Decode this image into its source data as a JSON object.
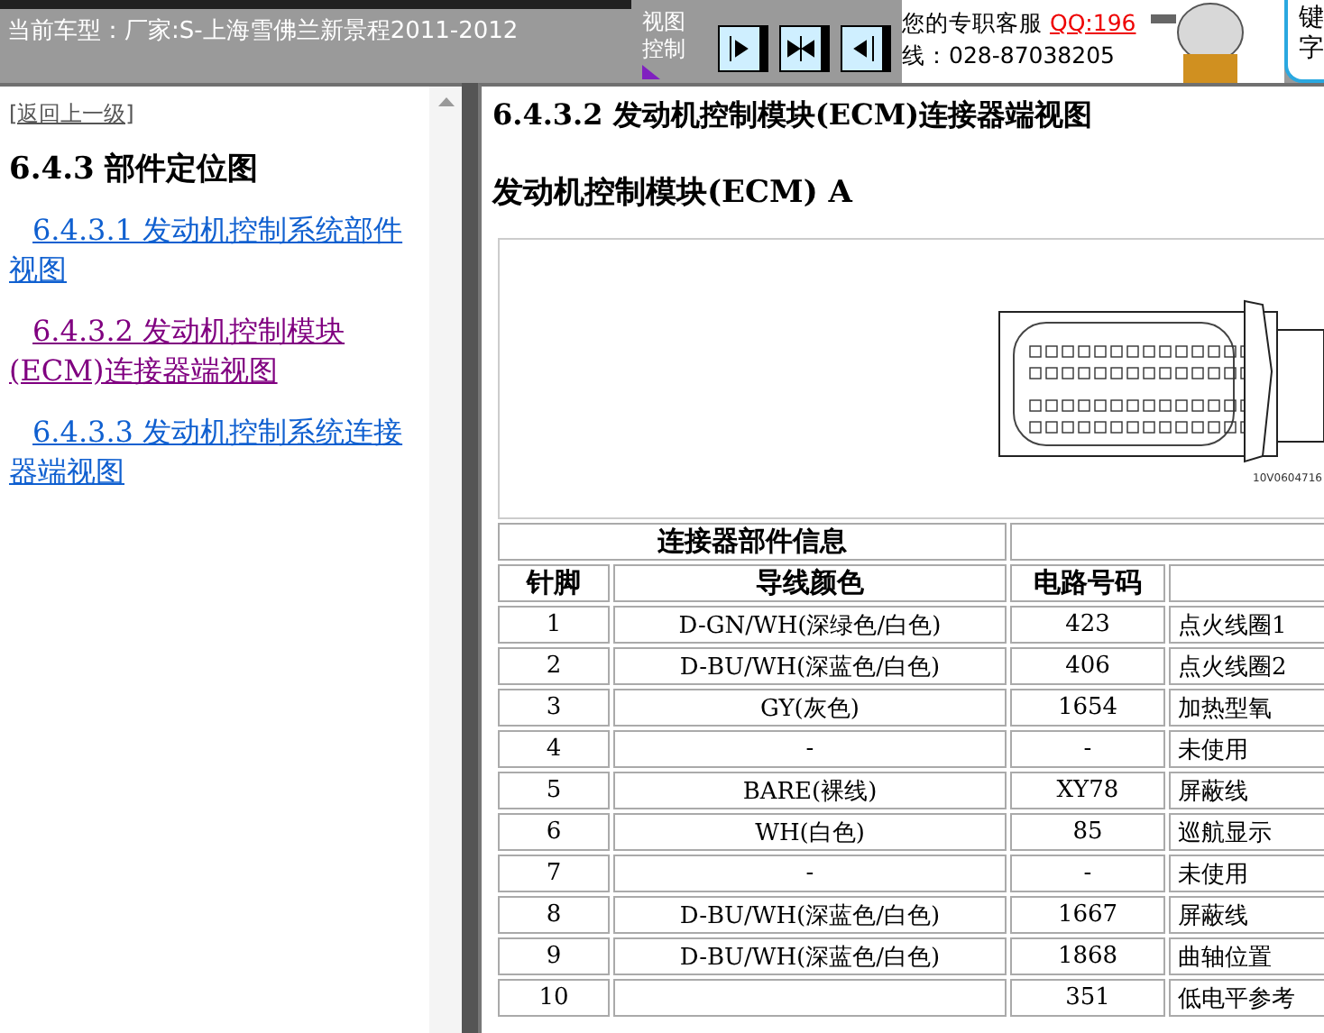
{
  "top_bar": {
    "current_model": "当前车型：厂家:S-上海雪佛兰新景程2011-2012",
    "view_control": "视图控制",
    "view_buttons": [
      {
        "kind": "expand"
      },
      {
        "kind": "split"
      },
      {
        "kind": "collapse"
      }
    ],
    "support": {
      "label": "您的专职客服",
      "qq": "QQ:196",
      "phone": "线：028-87038205"
    },
    "side_box": {
      "line_1": "键",
      "line_2": "字"
    }
  },
  "sidebar": {
    "back_link": "[返回上一级]",
    "heading": "6.4.3 部件定位图",
    "links": [
      {
        "text": "6.4.3.1 发动机控制系统部件视图",
        "visited": false
      },
      {
        "text": "6.4.3.2 发动机控制模块(ECM)连接器端视图",
        "visited": true
      },
      {
        "text": "6.4.3.3 发动机控制系统连接器端视图",
        "visited": false
      }
    ]
  },
  "content": {
    "title": "6.4.3.2 发动机控制模块(ECM)连接器端视图",
    "subtitle": "发动机控制模块(ECM) A",
    "figure_code": "10V0604716",
    "table": {
      "group_header": "连接器部件信息",
      "columns": [
        "针脚",
        "导线颜色",
        "电路号码"
      ],
      "rows": [
        [
          "1",
          "D-GN/WH(深绿色/白色)",
          "423",
          "点火线圈1"
        ],
        [
          "2",
          "D-BU/WH(深蓝色/白色)",
          "406",
          "点火线圈2"
        ],
        [
          "3",
          "GY(灰色)",
          "1654",
          "加热型氧"
        ],
        [
          "4",
          "-",
          "-",
          "未使用"
        ],
        [
          "5",
          "BARE(裸线)",
          "XY78",
          "屏蔽线"
        ],
        [
          "6",
          "WH(白色)",
          "85",
          "巡航显示"
        ],
        [
          "7",
          "-",
          "-",
          "未使用"
        ],
        [
          "8",
          "D-BU/WH(深蓝色/白色)",
          "1667",
          "屏蔽线"
        ],
        [
          "9",
          "D-BU/WH(深蓝色/白色)",
          "1868",
          "曲轴位置"
        ],
        [
          "10",
          "",
          "351",
          "低电平参考"
        ]
      ]
    }
  }
}
